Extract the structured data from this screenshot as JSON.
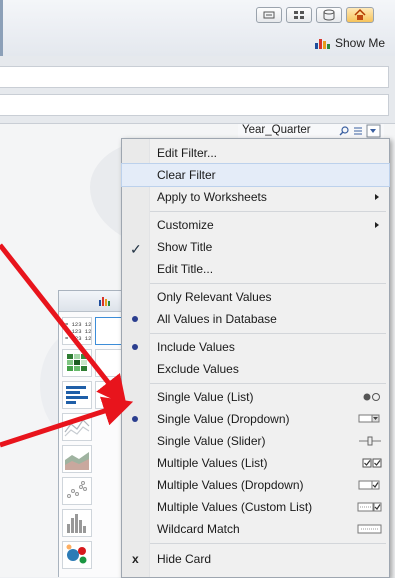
{
  "toolbar": {
    "show_me_label": "Show Me",
    "buttons": [
      "gallery-icon",
      "grid-icon",
      "database-icon",
      "home-icon"
    ]
  },
  "filter_card": {
    "title": "Year_Quarter",
    "icons": [
      "search-icon",
      "list-icon",
      "dropdown-arrow-icon"
    ]
  },
  "context_menu": {
    "items": [
      {
        "label": "Edit Filter..."
      },
      {
        "label": "Clear Filter",
        "highlighted": true
      },
      {
        "label": "Apply to Worksheets",
        "submenu": true
      },
      {
        "label": "Customize",
        "submenu": true
      },
      {
        "label": "Show Title",
        "checked": true
      },
      {
        "label": "Edit Title..."
      },
      {
        "label": "Only Relevant Values"
      },
      {
        "label": "All Values in Database",
        "selected": true
      },
      {
        "label": "Include Values",
        "selected": true
      },
      {
        "label": "Exclude Values"
      },
      {
        "label": "Single Value (List)",
        "icon": "radio-list-icon"
      },
      {
        "label": "Single Value (Dropdown)",
        "selected": true,
        "icon": "dropdown-icon"
      },
      {
        "label": "Single Value (Slider)",
        "icon": "slider-icon"
      },
      {
        "label": "Multiple Values (List)",
        "icon": "checkbox-list-icon"
      },
      {
        "label": "Multiple Values (Dropdown)",
        "icon": "checkbox-dropdown-icon"
      },
      {
        "label": "Multiple Values (Custom List)",
        "icon": "custom-list-icon"
      },
      {
        "label": "Wildcard Match",
        "icon": "wildcard-icon"
      },
      {
        "label": "Hide Card",
        "icon": "x-icon"
      }
    ]
  },
  "show_me_panel": {
    "thumb_text_line": "123 123"
  },
  "colors": {
    "menu_bg": "#f0f0f0",
    "highlight": "#e4ecf8",
    "radio_dot": "#2b3e8f",
    "annotation_arrow": "#e8141c"
  }
}
